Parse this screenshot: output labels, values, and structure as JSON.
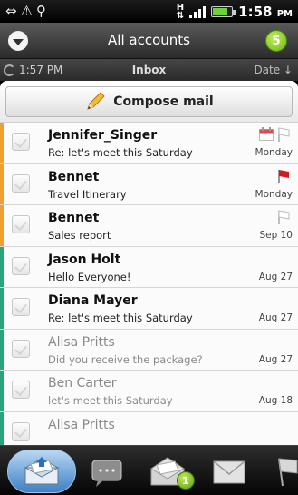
{
  "status_bar": {
    "network_type": "H",
    "time": "1:58",
    "time_suffix": "PM"
  },
  "header": {
    "title": "All accounts",
    "unread_count": "5"
  },
  "inbox_bar": {
    "last_sync": "1:57 PM",
    "folder": "Inbox",
    "sort": "Date ↓"
  },
  "compose": {
    "label": "Compose mail"
  },
  "messages": [
    {
      "sender": "Jennifer_Singer",
      "subject": "Re: let's meet this Saturday",
      "date": "Monday",
      "read": false,
      "flag": "outline",
      "calendar": true,
      "strip_color": "#f0a030"
    },
    {
      "sender": "Bennet",
      "subject": "Travel Itinerary",
      "date": "Monday",
      "read": false,
      "flag": "red",
      "calendar": false,
      "strip_color": "#f0a030"
    },
    {
      "sender": "Bennet",
      "subject": "Sales report",
      "date": "Sep 10",
      "read": false,
      "flag": "outline",
      "calendar": false,
      "strip_color": "#f0a030"
    },
    {
      "sender": "Jason Holt",
      "subject": "Hello Everyone!",
      "date": "Aug 27",
      "read": false,
      "flag": "none",
      "calendar": false,
      "strip_color": "#27a67a"
    },
    {
      "sender": "Diana Mayer",
      "subject": "Re: let's meet this Saturday",
      "date": "Aug 27",
      "read": false,
      "flag": "none",
      "calendar": false,
      "strip_color": "#27a67a"
    },
    {
      "sender": "Alisa Pritts",
      "subject": "Did you receive the package?",
      "date": "Aug 27",
      "read": true,
      "flag": "none",
      "calendar": false,
      "strip_color": "#27a67a"
    },
    {
      "sender": "Ben Carter",
      "subject": "let's meet this Saturday",
      "date": "Aug 18",
      "read": true,
      "flag": "none",
      "calendar": false,
      "strip_color": "#27a67a"
    },
    {
      "sender": "Alisa Pritts",
      "subject": "",
      "date": "",
      "read": true,
      "flag": "none",
      "calendar": false,
      "strip_color": "#27a67a"
    }
  ],
  "bottom_tabs": [
    {
      "icon": "inbox-envelope-icon",
      "active": true
    },
    {
      "icon": "conversation-icon",
      "active": false
    },
    {
      "icon": "open-envelope-icon",
      "active": false,
      "badge": "1"
    },
    {
      "icon": "envelope-icon",
      "active": false
    },
    {
      "icon": "flag-icon",
      "active": false
    }
  ],
  "colors": {
    "accent_blue": "#3e7fc4",
    "flag_red": "#d41b1b",
    "badge_green": "#6cb313"
  }
}
